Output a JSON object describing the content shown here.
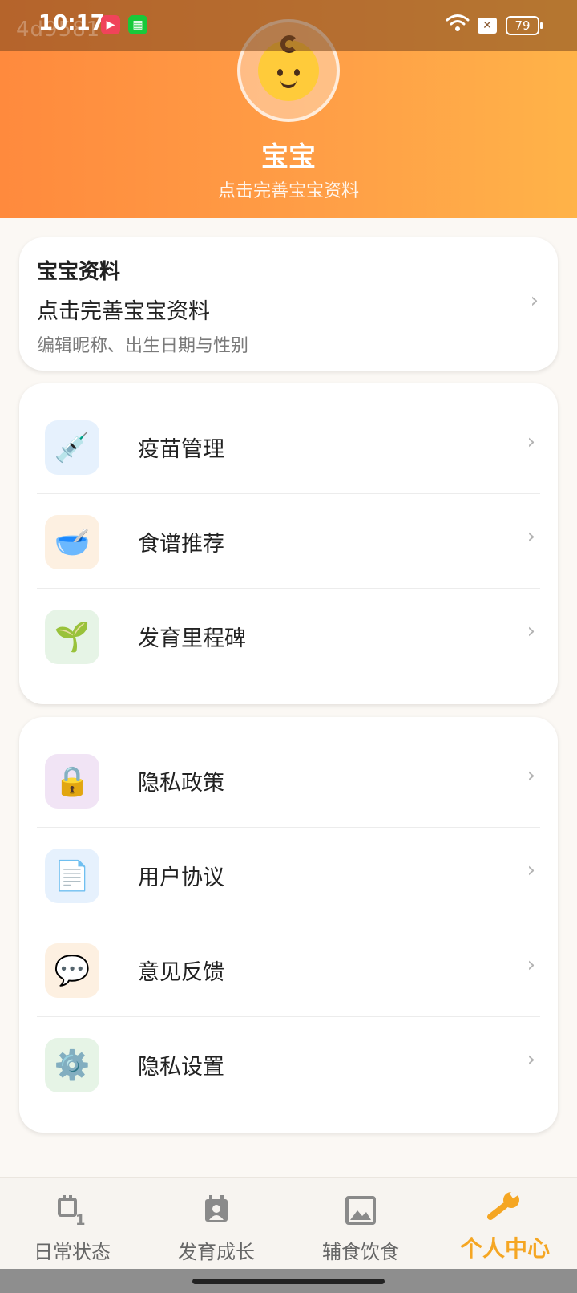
{
  "status_bar": {
    "time": "10:17",
    "watermark": "4d9581",
    "battery": "79",
    "app_icons": [
      "video-app-icon",
      "green-app-icon"
    ]
  },
  "profile": {
    "name": "宝宝",
    "subtitle": "点击完善宝宝资料",
    "avatar": "baby-icon"
  },
  "info_card": {
    "title": "宝宝资料",
    "main": "点击完善宝宝资料",
    "desc": "编辑昵称、出生日期与性别"
  },
  "group1": [
    {
      "label": "疫苗管理",
      "icon": "syringe-icon",
      "emoji": "💉",
      "bg": "#e6f1fd"
    },
    {
      "label": "食谱推荐",
      "icon": "bowl-icon",
      "emoji": "🥣",
      "bg": "#fdf0e1"
    },
    {
      "label": "发育里程碑",
      "icon": "sprout-icon",
      "emoji": "🌱",
      "bg": "#e6f4e6"
    }
  ],
  "group2": [
    {
      "label": "隐私政策",
      "icon": "lock-icon",
      "emoji": "🔒",
      "bg": "#f1e4f5"
    },
    {
      "label": "用户协议",
      "icon": "document-icon",
      "emoji": "📄",
      "bg": "#e6f1fd"
    },
    {
      "label": "意见反馈",
      "icon": "speech-bubble-icon",
      "emoji": "💬",
      "bg": "#fdf0e1"
    },
    {
      "label": "隐私设置",
      "icon": "gear-icon",
      "emoji": "⚙️",
      "bg": "#e6f4e6"
    }
  ],
  "chevron": "›",
  "bottom_nav": {
    "tabs": [
      {
        "label": "日常状态",
        "icon": "calendar-icon",
        "active": false
      },
      {
        "label": "发育成长",
        "icon": "growth-icon",
        "active": false
      },
      {
        "label": "辅食饮食",
        "icon": "image-icon",
        "active": false
      },
      {
        "label": "个人中心",
        "icon": "wrench-icon",
        "active": true
      }
    ],
    "active_color": "#f5a623"
  },
  "colors": {
    "header_gradient_start": "#ff8a3d",
    "header_gradient_end": "#ffb348",
    "background": "#fbf8f4"
  }
}
